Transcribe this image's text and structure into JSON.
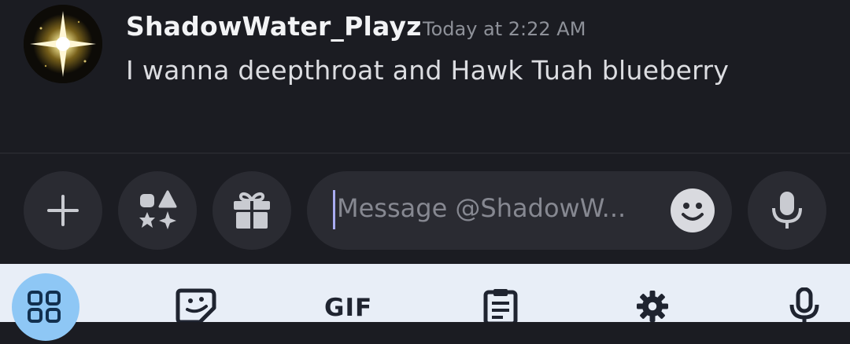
{
  "message": {
    "author": "ShadowWater_Playz",
    "timestamp": "Today at 2:22 AM",
    "text": "I wanna deepthroat and Hawk Tuah blueberry"
  },
  "composer": {
    "buttons": [
      "plus-icon",
      "apps-icon",
      "gift-icon"
    ],
    "input_placeholder": "Message @ShadowW...",
    "emoji_icon": "smiley-icon",
    "voice_icon": "microphone-icon"
  },
  "keyboard_toolbar": {
    "items": [
      "apps-grid-icon",
      "sticker-icon",
      "GIF",
      "clipboard-icon",
      "settings-gear-icon",
      "microphone-icon"
    ],
    "gif_label": "GIF"
  },
  "colors": {
    "background": "#1b1c22",
    "button_bg": "#2a2b32",
    "keyboard_bg": "#e8eef7",
    "keyboard_active": "#8ec7f5",
    "caret": "#a9acf2"
  }
}
